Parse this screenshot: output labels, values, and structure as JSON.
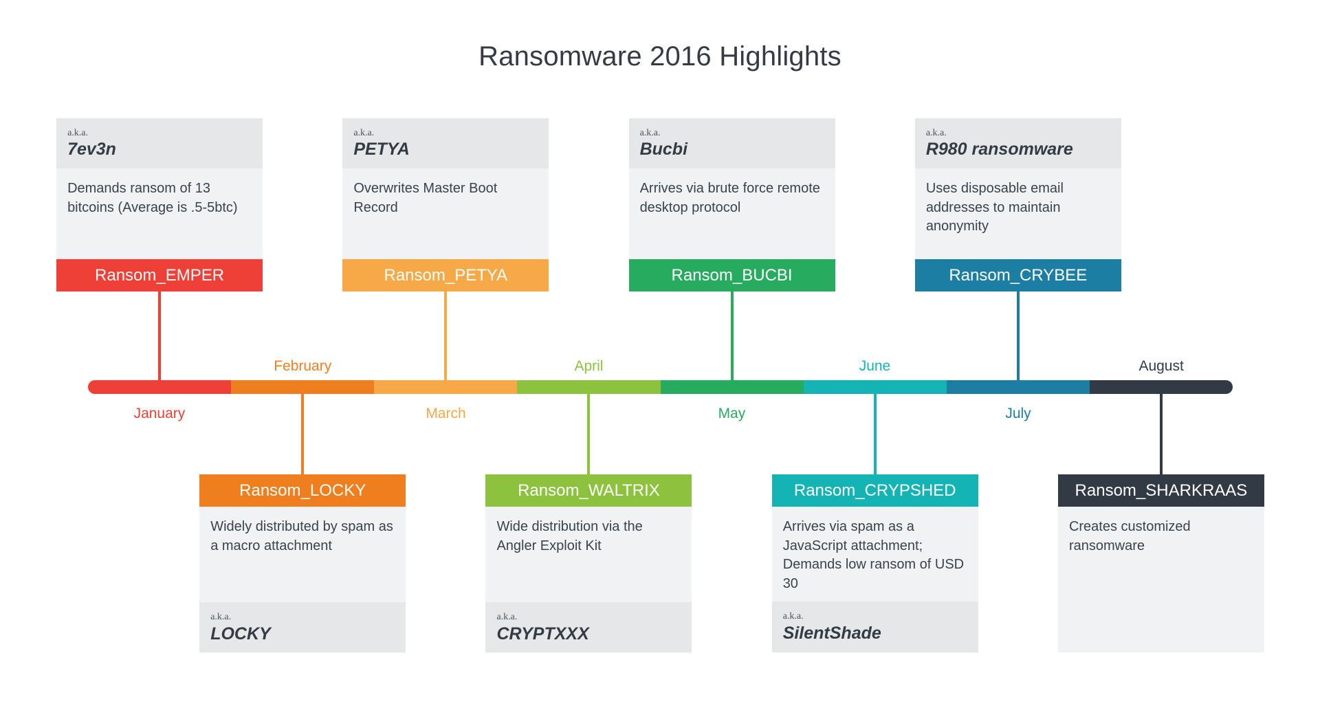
{
  "title": "Ransomware 2016 Highlights",
  "aka_prefix": "a.k.a.",
  "colors": {
    "january": "#ee4036",
    "february": "#ef7f1e",
    "march": "#f7a947",
    "april": "#8dc23f",
    "may": "#27ab5f",
    "june": "#14b4b4",
    "july": "#1c7ea3",
    "august": "#323a45",
    "card_header_bg": "#e5e7e8",
    "card_body_bg": "#f1f2f4",
    "text": "#333b44"
  },
  "timeline": {
    "months": [
      {
        "name": "January",
        "color_key": "january",
        "position": "below"
      },
      {
        "name": "February",
        "color_key": "february",
        "position": "above"
      },
      {
        "name": "March",
        "color_key": "march",
        "position": "below"
      },
      {
        "name": "April",
        "color_key": "april",
        "position": "above"
      },
      {
        "name": "May",
        "color_key": "may",
        "position": "below"
      },
      {
        "name": "June",
        "color_key": "june",
        "position": "above"
      },
      {
        "name": "July",
        "color_key": "july",
        "position": "below"
      },
      {
        "name": "August",
        "color_key": "august",
        "position": "above"
      }
    ]
  },
  "top_cards": [
    {
      "aka": "7ev3n",
      "description": "Demands ransom of 13 bitcoins (Average is .5-5btc)",
      "label": "Ransom_EMPER",
      "color": "#ee4036",
      "month": "January"
    },
    {
      "aka": "PETYA",
      "description": "Overwrites Master Boot Record",
      "label": "Ransom_PETYA",
      "color": "#f7a947",
      "month": "March"
    },
    {
      "aka": "Bucbi",
      "description": "Arrives via brute force remote desktop protocol",
      "label": "Ransom_BUCBI",
      "color": "#27ab5f",
      "month": "May"
    },
    {
      "aka": "R980 ransomware",
      "description": "Uses disposable email addresses to maintain anonymity",
      "label": "Ransom_CRYBEE",
      "color": "#1c7ea3",
      "month": "July"
    }
  ],
  "bottom_cards": [
    {
      "label": "Ransom_LOCKY",
      "description": "Widely distributed by spam as a macro attachment",
      "aka": "LOCKY",
      "color": "#ef7f1e",
      "month": "February"
    },
    {
      "label": "Ransom_WALTRIX",
      "description": "Wide distribution via the Angler Exploit Kit",
      "aka": "CRYPTXXX",
      "color": "#8dc23f",
      "month": "April"
    },
    {
      "label": "Ransom_CRYPSHED",
      "description": "Arrives via spam as a JavaScript attachment; Demands low ransom of USD 30",
      "aka": "SilentShade",
      "color": "#14b4b4",
      "month": "June"
    },
    {
      "label": "Ransom_SHARKRAAS",
      "description": "Creates customized ransomware",
      "aka": "",
      "color": "#323a45",
      "month": "August"
    }
  ]
}
